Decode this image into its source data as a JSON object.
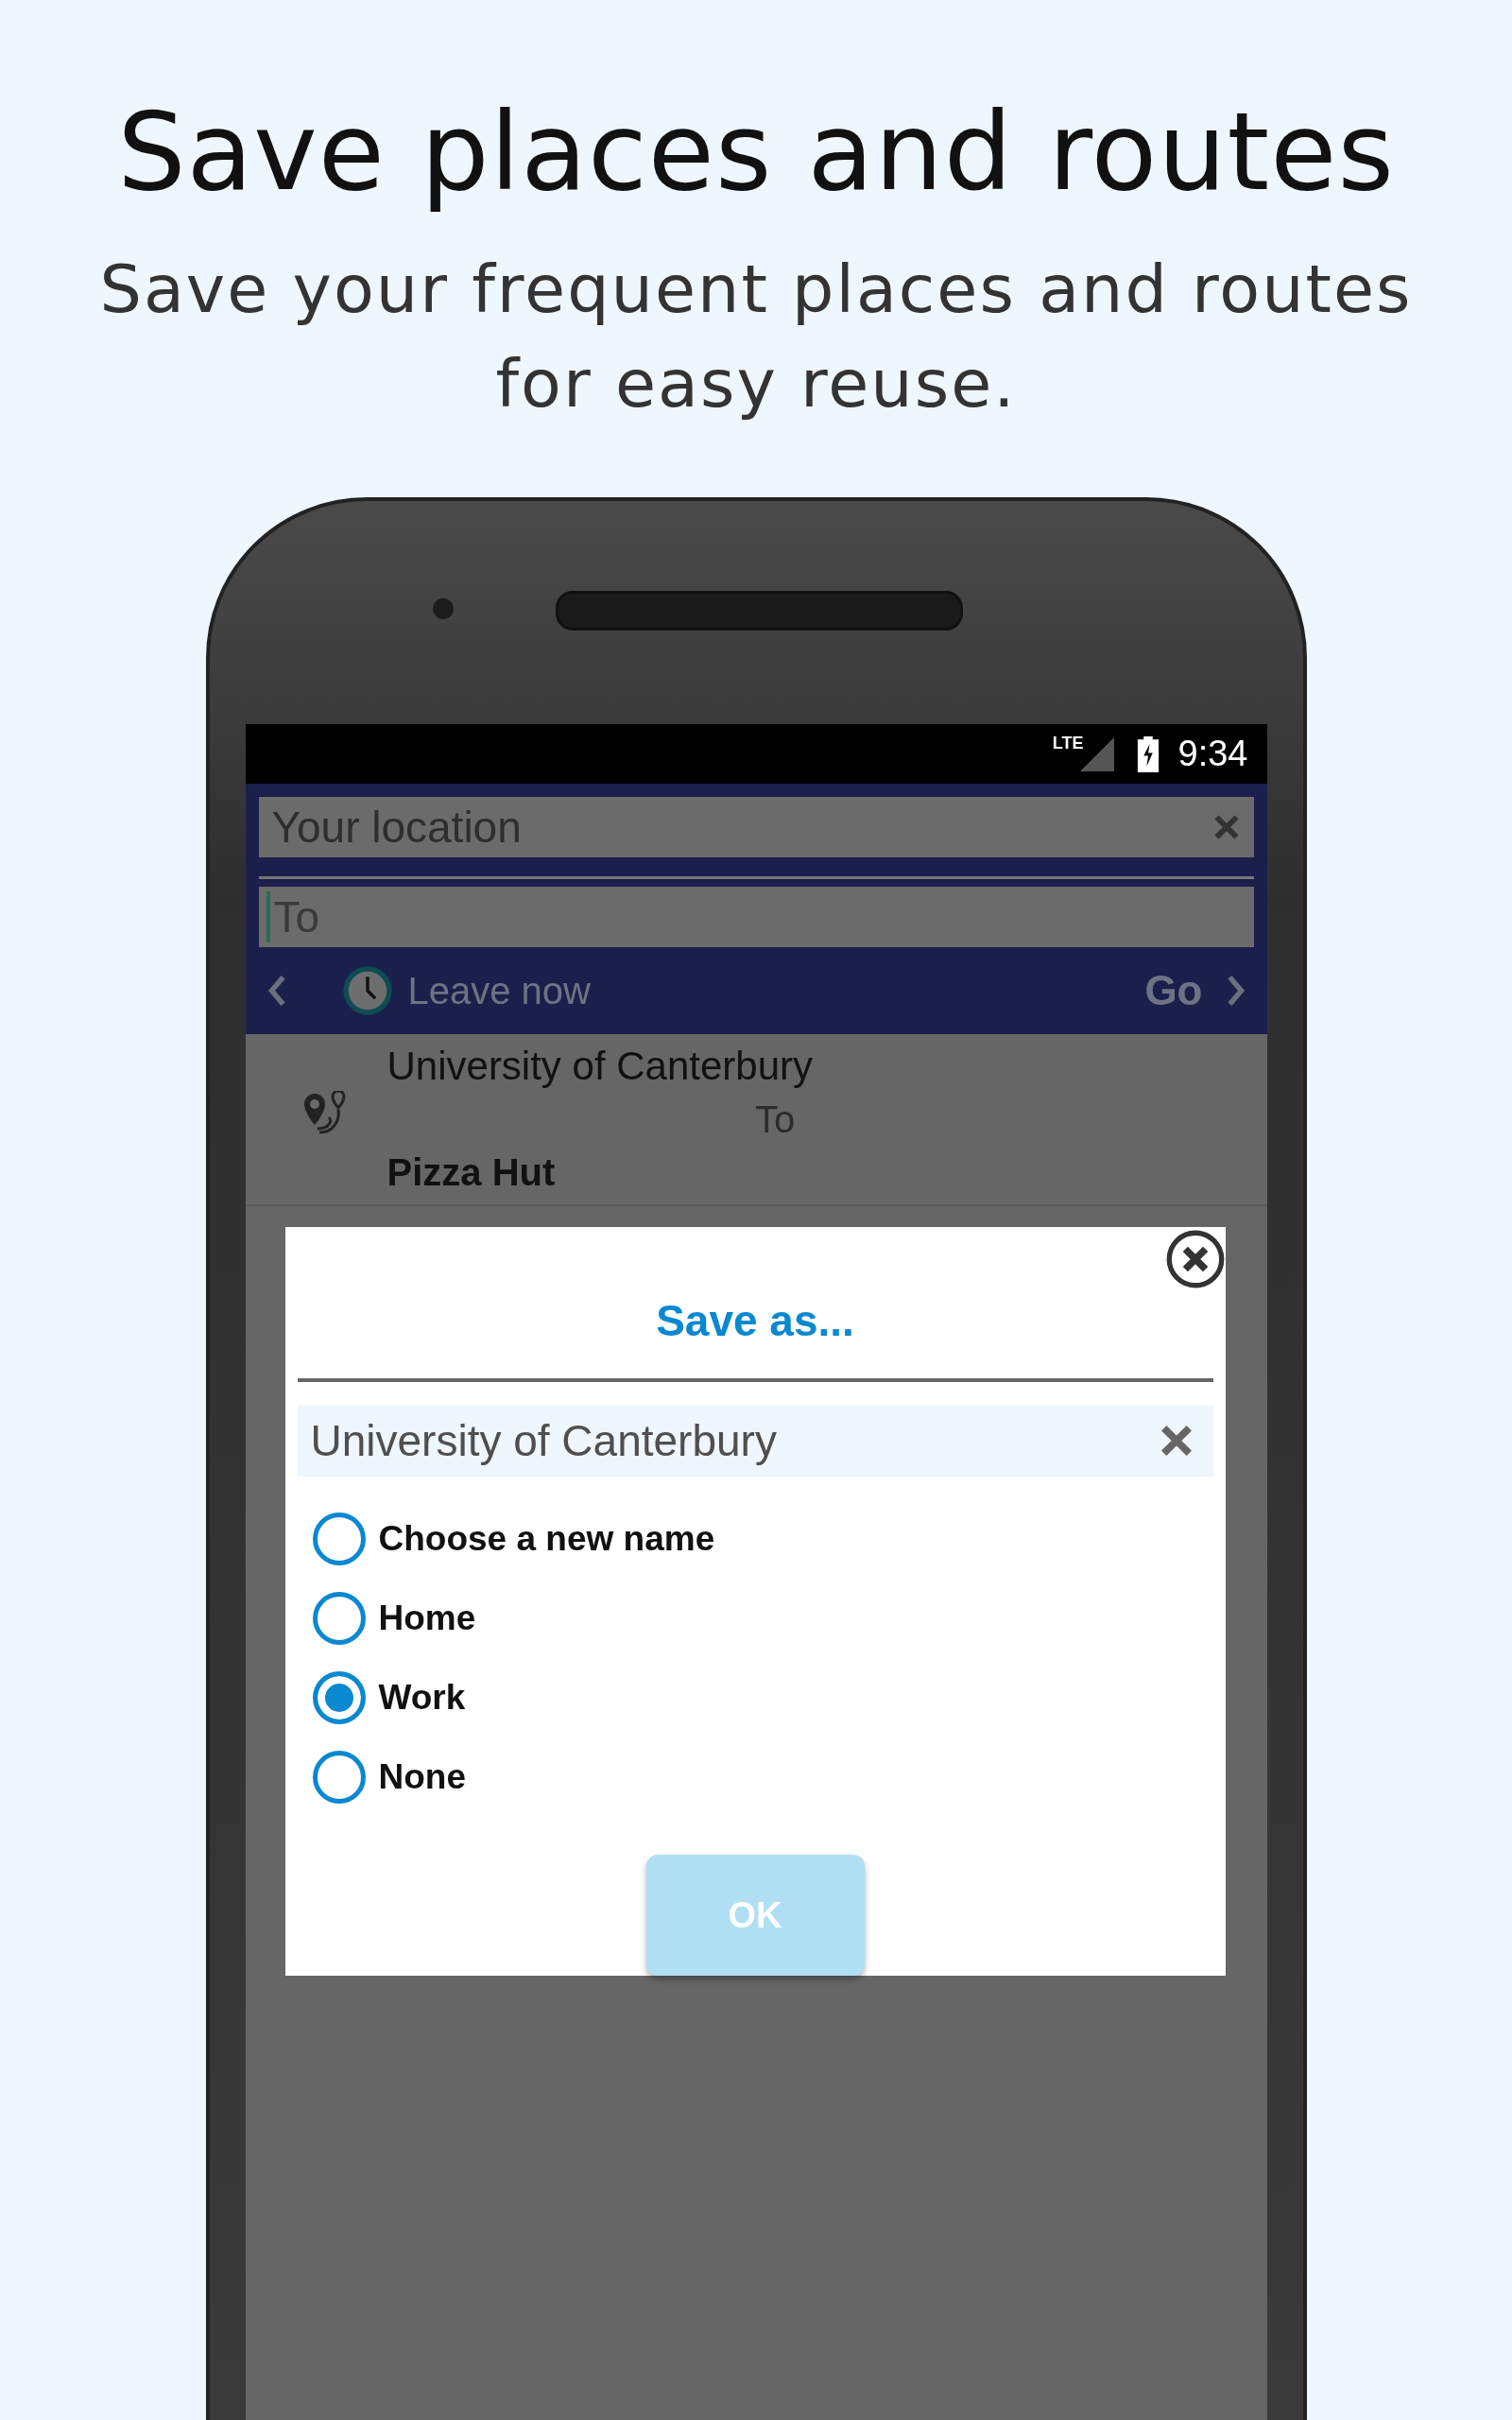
{
  "headline": "Save places and routes",
  "subtitle": "Save your frequent places and routes for easy reuse.",
  "status_bar": {
    "network": "LTE",
    "time": "9:34"
  },
  "search": {
    "from_field": {
      "value": "Your location"
    },
    "to_field": {
      "placeholder": "To"
    },
    "leave_button": "Leave now",
    "go_button": "Go"
  },
  "routes": [
    {
      "from": "University of Canterbury",
      "connector": "To",
      "to": "Pizza Hut"
    }
  ],
  "dialog": {
    "title": "Save as...",
    "name_field": {
      "value": "University of Canterbury"
    },
    "options": [
      {
        "label": "Choose a new name",
        "selected": false
      },
      {
        "label": "Home",
        "selected": false
      },
      {
        "label": "Work",
        "selected": true
      },
      {
        "label": "None",
        "selected": false
      }
    ],
    "ok_button": {
      "label": "OK",
      "disabled": true
    }
  }
}
